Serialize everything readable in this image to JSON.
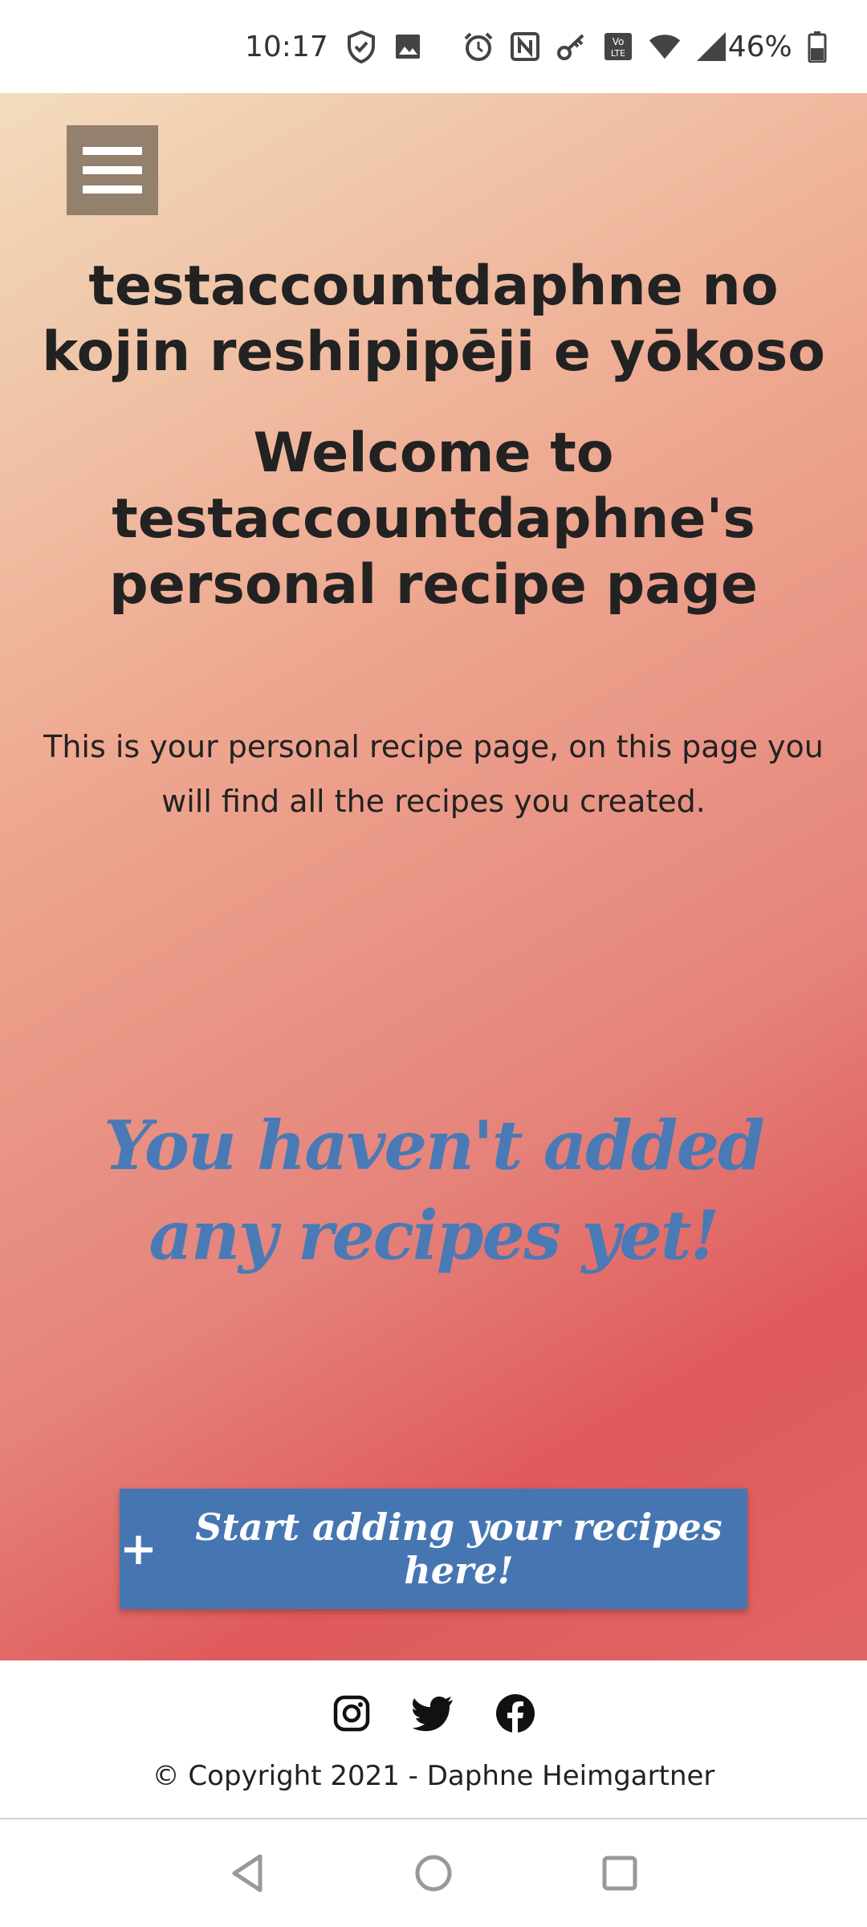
{
  "status_bar": {
    "time": "10:17",
    "battery": "46%",
    "icons": [
      "shield-check-icon",
      "image-icon",
      "alarm-icon",
      "nfc-icon",
      "key-icon",
      "volte-icon",
      "wifi-icon",
      "signal-icon",
      "battery-icon"
    ]
  },
  "header": {
    "menu_icon": "hamburger-menu-icon"
  },
  "main": {
    "title_jp": "testaccountdaphne no kojin reshipipēji e yōkoso",
    "title_en": "Welcome to testaccountdaphne's personal recipe page",
    "intro": "This is your personal recipe page, on this page you will find all the recipes you created.",
    "empty_message": "You haven't added any recipes yet!",
    "add_button_icon": "+",
    "add_button_label": "Start adding your recipes here!"
  },
  "footer": {
    "social": [
      "instagram-icon",
      "twitter-icon",
      "facebook-icon"
    ],
    "copyright": "© Copyright 2021 - Daphne Heimgartner"
  },
  "nav": {
    "buttons": [
      "back-icon",
      "home-icon",
      "recents-icon"
    ]
  },
  "colors": {
    "accent": "#4676b2",
    "menu_button": "#93806d",
    "gradient_start": "#f2dcbc",
    "gradient_end": "#df5a5a"
  }
}
